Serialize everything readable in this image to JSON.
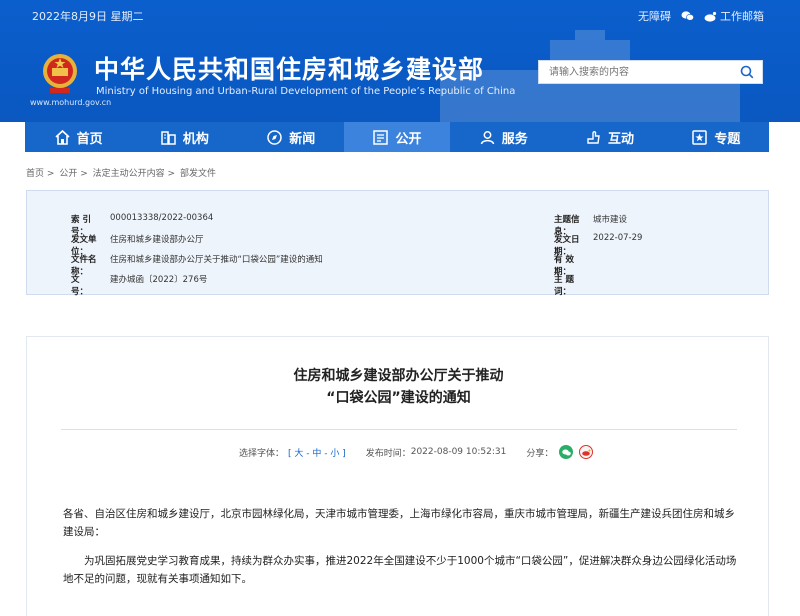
{
  "topbar": {
    "date": "2022年8月9日 星期二",
    "accessibility": "无障碍",
    "work_email": "工作邮箱",
    "icons": [
      "wechat-icon",
      "weibo-icon"
    ]
  },
  "header": {
    "title": "中华人民共和国住房和城乡建设部",
    "subtitle": "Ministry of Housing and Urban-Rural Development of the People’s Republic of China",
    "domain": "www.mohurd.gov.cn",
    "search_placeholder": "请输入搜索的内容"
  },
  "nav": {
    "items": [
      {
        "label": "首页",
        "icon": "home-icon"
      },
      {
        "label": "机构",
        "icon": "building-icon"
      },
      {
        "label": "新闻",
        "icon": "news-icon"
      },
      {
        "label": "公开",
        "icon": "disclosure-icon",
        "active": true
      },
      {
        "label": "服务",
        "icon": "service-icon"
      },
      {
        "label": "互动",
        "icon": "interact-icon"
      },
      {
        "label": "专题",
        "icon": "topic-icon"
      }
    ]
  },
  "breadcrumb": {
    "items": [
      "首页",
      "公开",
      "法定主动公开内容",
      "部发文件"
    ],
    "separator": ">"
  },
  "meta": {
    "index_label": "索 引 号：",
    "index_value": "000013338/2022-00364",
    "issuer_label": "发文单位：",
    "issuer_value": "住房和城乡建设部办公厅",
    "docname_label": "文件名称：",
    "docname_value": "住房和城乡建设部办公厅关于推动“口袋公园”建设的通知",
    "docno_label": "文　　号：",
    "docno_value": "建办城函〔2022〕276号",
    "topic_label": "主题信息：",
    "topic_value": "城市建设",
    "date_label": "发文日期：",
    "date_value": "2022-07-29",
    "validity_label": "有 效 期：",
    "validity_value": "",
    "keywords_label": "主 题 词：",
    "keywords_value": ""
  },
  "article": {
    "title_line1": "住房和城乡建设部办公厅关于推动",
    "title_line2": "“口袋公园”建设的通知",
    "font_label": "选择字体：",
    "font_options": "[ 大 - 中 - 小 ]",
    "pub_label": "发布时间：",
    "pub_time": "2022-08-09 10:52:31",
    "share_label": "分享：",
    "para1": "各省、自治区住房和城乡建设厅，北京市园林绿化局，天津市城市管理委，上海市绿化市容局，重庆市城市管理局，新疆生产建设兵团住房和城乡建设局：",
    "para2": "为巩固拓展党史学习教育成果，持续为群众办实事，推进2022年全国建设不少于1000个城市“口袋公园”，促进解决群众身边公园绿化活动场地不足的问题，现就有关事项通知如下。"
  },
  "colors": {
    "header_blue": "#0b5fcc",
    "nav_blue": "#1766c9",
    "nav_active": "#3b83dc",
    "meta_bg": "#eef4fb"
  }
}
